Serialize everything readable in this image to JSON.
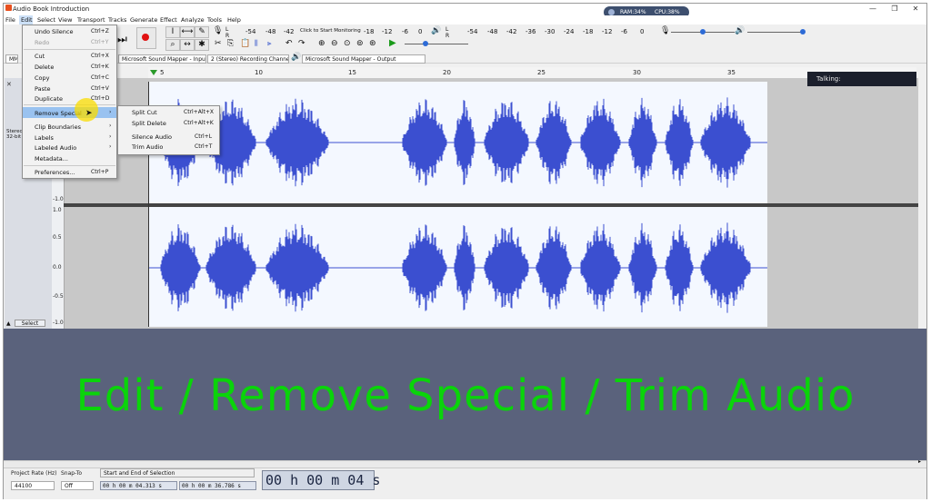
{
  "window": {
    "title": "Audio Book Introduction",
    "minimize": "—",
    "maximize": "❐",
    "close": "✕"
  },
  "menubar": [
    "File",
    "Edit",
    "Select",
    "View",
    "Transport",
    "Tracks",
    "Generate",
    "Effect",
    "Analyze",
    "Tools",
    "Help"
  ],
  "system_monitor": {
    "ram": "RAM:34%",
    "cpu": "CPU:38%"
  },
  "meters": {
    "record_scale": [
      "-54",
      "-48",
      "-42",
      "Click to Start Monitoring",
      "-18",
      "-12",
      "-6",
      "0"
    ],
    "playback_scale": [
      "-54",
      "-48",
      "-42",
      "-36",
      "-30",
      "-24",
      "-18",
      "-12",
      "-6",
      "0"
    ]
  },
  "devices": {
    "host": "MME",
    "input": "Microsoft Sound Mapper - Input",
    "channels": "2 (Stereo) Recording Channels",
    "output": "Microsoft Sound Mapper - Output"
  },
  "ruler": {
    "ticks": [
      "5",
      "10",
      "15",
      "20",
      "25",
      "30",
      "35"
    ]
  },
  "track": {
    "info": "Stereo, 32-bit",
    "select_label": "Select",
    "scale_labels": [
      "1.0",
      "0.5",
      "0.0",
      "-0.5",
      "-1.0"
    ]
  },
  "talking_label": "Talking:",
  "edit_menu": {
    "items": [
      {
        "label": "Undo Silence",
        "shortcut": "Ctrl+Z",
        "disabled": false
      },
      {
        "label": "Redo",
        "shortcut": "Ctrl+Y",
        "disabled": true
      },
      {
        "label": "Cut",
        "shortcut": "Ctrl+X",
        "disabled": false
      },
      {
        "label": "Delete",
        "shortcut": "Ctrl+K",
        "disabled": false
      },
      {
        "label": "Copy",
        "shortcut": "Ctrl+C",
        "disabled": false
      },
      {
        "label": "Paste",
        "shortcut": "Ctrl+V",
        "disabled": false
      },
      {
        "label": "Duplicate",
        "shortcut": "Ctrl+D",
        "disabled": false
      },
      {
        "label": "Remove Special",
        "shortcut": "",
        "disabled": false
      },
      {
        "label": "Clip Boundaries",
        "shortcut": "",
        "disabled": false
      },
      {
        "label": "Labels",
        "shortcut": "",
        "disabled": false
      },
      {
        "label": "Labeled Audio",
        "shortcut": "",
        "disabled": false
      },
      {
        "label": "Metadata...",
        "shortcut": "",
        "disabled": false
      },
      {
        "label": "Preferences...",
        "shortcut": "Ctrl+P",
        "disabled": false
      }
    ]
  },
  "remove_special_menu": {
    "items": [
      {
        "label": "Split Cut",
        "shortcut": "Ctrl+Alt+X"
      },
      {
        "label": "Split Delete",
        "shortcut": "Ctrl+Alt+K"
      },
      {
        "label": "Silence Audio",
        "shortcut": "Ctrl+L"
      },
      {
        "label": "Trim Audio",
        "shortcut": "Ctrl+T"
      }
    ]
  },
  "caption": "Edit / Remove Special / Trim Audio",
  "bottom": {
    "project_rate_label": "Project Rate (Hz)",
    "project_rate_value": "44100",
    "snap_label": "Snap-To",
    "snap_value": "Off",
    "selection_label": "Start and End of Selection",
    "selection_start": "00 h 00 m 04.313 s",
    "selection_end": "00 h 00 m 36.786 s",
    "audio_position": "00 h 00 m 04 s"
  },
  "colors": {
    "waveform": "#3b4fd0",
    "selection": "#f4f8ff",
    "caption": "#0ad40a",
    "lower_panel": "#5a627c"
  }
}
